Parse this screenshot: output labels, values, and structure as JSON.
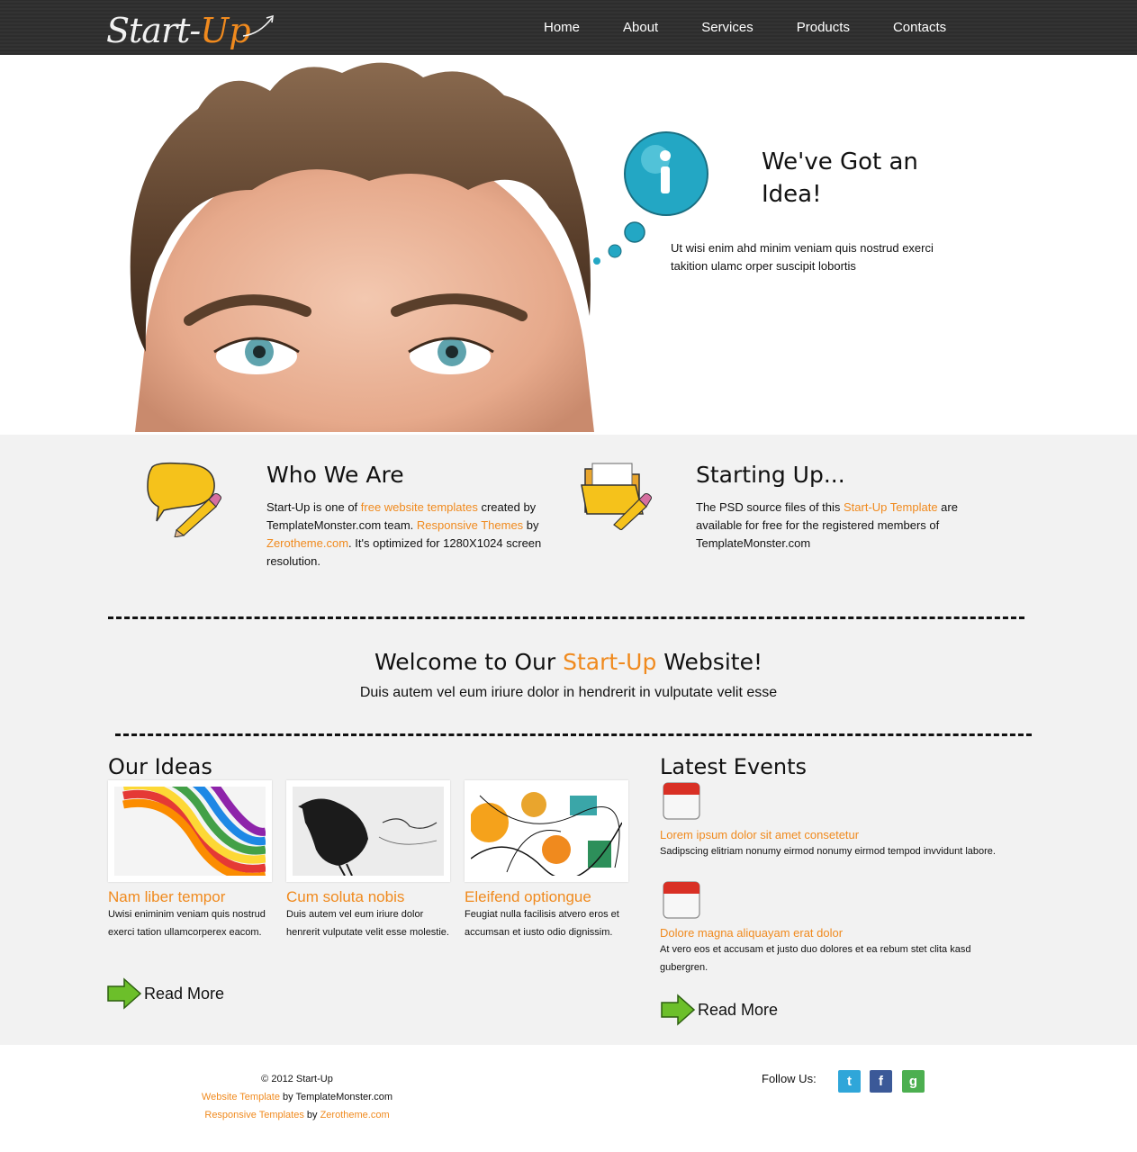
{
  "header": {
    "logo_start": "Start-",
    "logo_up": "Up",
    "nav": [
      "Home",
      "About",
      "Services",
      "Products",
      "Contacts"
    ]
  },
  "hero": {
    "title": "We've Got an Idea!",
    "text": "Ut wisi enim ahd minim veniam quis nostrud exerci takition ulamc orper suscipit lobortis",
    "bubble_icon": "info-icon"
  },
  "who": {
    "title": "Who We Are",
    "icon": "speech-bubble-pencil-icon",
    "text_1": "Start-Up is one of ",
    "link_1": "free website templates",
    "text_2": " created by TemplateMonster.com team. ",
    "link_2": "Responsive Themes",
    "text_3": " by ",
    "link_3": "Zerotheme.com",
    "text_4": ". It's optimized for 1280X1024 screen resolution."
  },
  "starting": {
    "title": "Starting Up...",
    "icon": "folder-pencil-icon",
    "text_1": "The PSD source files of this ",
    "link_1": "Start-Up Template",
    "text_2": " are available for free for the registered members of TemplateMonster.com"
  },
  "welcome": {
    "title_pre": "Welcome to Our ",
    "title_accent": "Start-Up",
    "title_post": " Website!",
    "subtitle": "Duis autem vel eum iriure dolor in hendrerit in vulputate velit esse"
  },
  "ideas": {
    "title": "Our Ideas",
    "items": [
      {
        "title": "Nam liber tempor",
        "text": "Uwisi eniminim veniam quis nostrud exerci tation ullamcorperex eacom."
      },
      {
        "title": "Cum soluta nobis",
        "text": "Duis autem vel eum iriure dolor henrerit vulputate velit esse molestie."
      },
      {
        "title": "Eleifend optiongue",
        "text": "Feugiat nulla facilisis atvero eros et accumsan et iusto odio dignissim."
      }
    ],
    "read_more": "Read More"
  },
  "events": {
    "title": "Latest Events",
    "items": [
      {
        "title": "Lorem ipsum dolor sit amet consetetur",
        "text": "Sadipscing elitriam nonumy eirmod nonumy eirmod tempod invvidunt labore."
      },
      {
        "title": "Dolore magna aliquayam erat dolor",
        "text": "At vero eos et accusam et justo duo dolores et ea rebum stet clita kasd gubergren."
      }
    ],
    "read_more": "Read More"
  },
  "footer": {
    "copyright": "© 2012 Start-Up",
    "line2_link": "Website Template",
    "line2_text": " by TemplateMonster.com",
    "line3_link": "Responsive Templates",
    "line3_by": " by ",
    "line3_link2": "Zerotheme.com",
    "follow": "Follow Us:",
    "social": [
      "twitter-icon",
      "facebook-icon",
      "google-icon"
    ],
    "social_glyphs": [
      "t",
      "f",
      "g"
    ]
  },
  "colors": {
    "accent": "#f08a1e",
    "header_bg": "#2d2d2d",
    "main_bg": "#f2f2f2",
    "bubble": "#23a7c4"
  }
}
